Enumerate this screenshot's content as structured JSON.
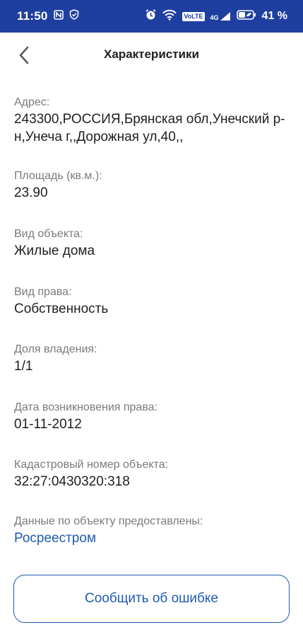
{
  "status_bar": {
    "time": "11:50",
    "volte": "VoLTE",
    "network": "4G",
    "battery": "41 %",
    "background_color": "#1f3fa0"
  },
  "header": {
    "title": "Характеристики"
  },
  "fields": [
    {
      "label": "Адрес:",
      "value": "243300,РОССИЯ,Брянская обл,Унечский р-н,Унеча г,,Дорожная ул,40,,"
    },
    {
      "label": "Площадь (кв.м.):",
      "value": "23.90"
    },
    {
      "label": "Вид объекта:",
      "value": "Жилые дома"
    },
    {
      "label": "Вид права:",
      "value": "Собственность"
    },
    {
      "label": "Доля владения:",
      "value": "1/1"
    },
    {
      "label": "Дата возникновения права:",
      "value": "01-11-2012"
    },
    {
      "label": "Кадастровый номер объекта:",
      "value": "32:27:0430320:318"
    },
    {
      "label": "Данные по объекту предоставлены:",
      "link": "Росреестром"
    }
  ],
  "report_button": {
    "label": "Сообщить об ошибке"
  },
  "colors": {
    "accent": "#1f5bb0",
    "label_gray": "#7a7a7a"
  }
}
